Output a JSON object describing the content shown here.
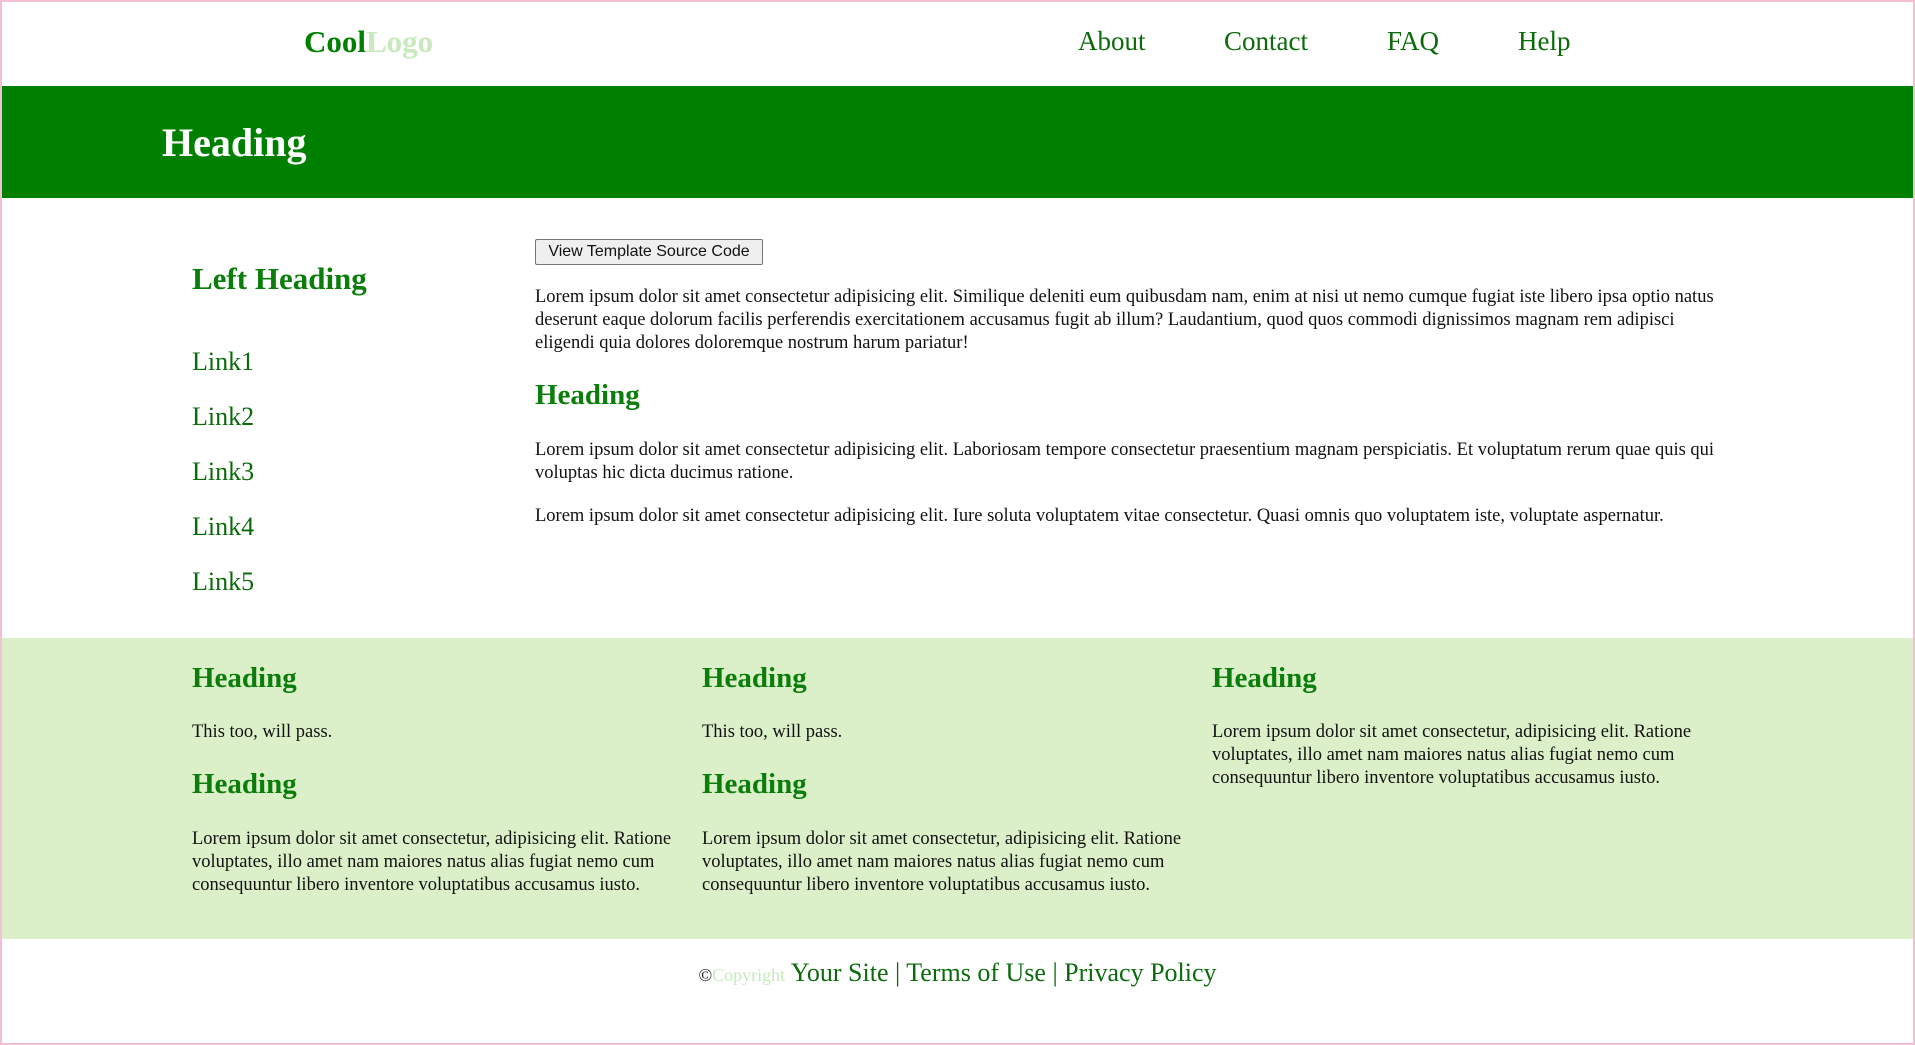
{
  "header": {
    "logo_part1": "Cool",
    "logo_part2": "Logo",
    "nav": [
      "About",
      "Contact",
      "FAQ",
      "Help"
    ]
  },
  "banner": {
    "title": "Heading"
  },
  "sidebar": {
    "heading": "Left Heading",
    "links": [
      "Link1",
      "Link2",
      "Link3",
      "Link4",
      "Link5"
    ]
  },
  "main": {
    "button_label": "View Template Source Code",
    "para1": "Lorem ipsum dolor sit amet consectetur adipisicing elit. Similique deleniti eum quibusdam nam, enim at nisi ut nemo cumque fugiat iste libero ipsa optio natus deserunt eaque dolorum facilis perferendis exercitationem accusamus fugit ab illum? Laudantium, quod quos commodi dignissimos magnam rem adipisci eligendi quia dolores doloremque nostrum harum pariatur!",
    "heading": "Heading",
    "para2": "Lorem ipsum dolor sit amet consectetur adipisicing elit. Laboriosam tempore consectetur praesentium magnam perspiciatis. Et voluptatum rerum quae quis qui voluptas hic dicta ducimus ratione.",
    "para3": "Lorem ipsum dolor sit amet consectetur adipisicing elit. Iure soluta voluptatem vitae consectetur. Quasi omnis quo voluptatem iste, voluptate aspernatur."
  },
  "footer_columns": {
    "col1": {
      "heading1": "Heading",
      "text1": "This too, will pass.",
      "heading2": "Heading",
      "text2": "Lorem ipsum dolor sit amet consectetur, adipisicing elit. Ratione voluptates, illo amet nam maiores natus alias fugiat nemo cum consequuntur libero inventore voluptatibus accusamus iusto."
    },
    "col2": {
      "heading1": "Heading",
      "text1": "This too, will pass.",
      "heading2": "Heading",
      "text2": "Lorem ipsum dolor sit amet consectetur, adipisicing elit. Ratione voluptates, illo amet nam maiores natus alias fugiat nemo cum consequuntur libero inventore voluptatibus accusamus iusto."
    },
    "col3": {
      "heading1": "Heading",
      "text1": "Lorem ipsum dolor sit amet consectetur, adipisicing elit. Ratione voluptates, illo amet nam maiores natus alias fugiat nemo cum consequuntur libero inventore voluptatibus accusamus iusto."
    }
  },
  "copyright": {
    "symbol": "©",
    "label": "Copyright",
    "site": "Your Site",
    "sep": "|",
    "terms": "Terms of Use",
    "privacy": "Privacy Policy"
  },
  "colors": {
    "brand_green": "#008000",
    "light_green": "#dbf0c9",
    "logo_light": "#c8e9bd"
  }
}
